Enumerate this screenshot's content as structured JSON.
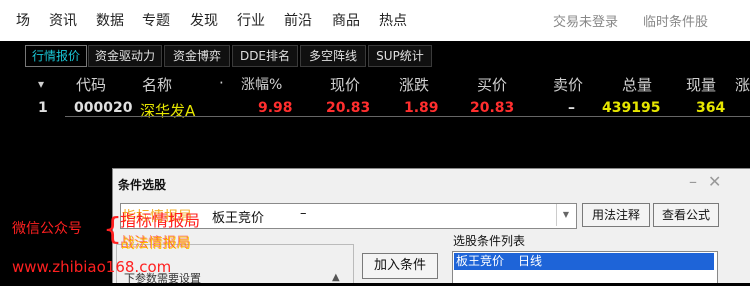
{
  "menu": {
    "items": [
      "场",
      "资讯",
      "数据",
      "专题",
      "发现",
      "行业",
      "前沿",
      "商品",
      "热点"
    ],
    "login_status": "交易未登录",
    "condition_stock": "临时条件股"
  },
  "tabs": [
    "行情报价",
    "资金驱动力",
    "资金博弈",
    "DDE排名",
    "多空阵线",
    "SUP统计"
  ],
  "table": {
    "sort_indicator": "▾",
    "dot": "·",
    "headers": [
      "代码",
      "名称",
      "涨幅%",
      "现价",
      "涨跌",
      "买价",
      "卖价",
      "总量",
      "现量",
      "涨"
    ],
    "rows": [
      {
        "index": "1",
        "code": "000020",
        "name": "深华发A",
        "change_pct": "9.98",
        "price": "20.83",
        "change": "1.89",
        "bid": "20.83",
        "ask": "–",
        "volume": "439195",
        "current_volume": "364"
      }
    ]
  },
  "dialog": {
    "title": "条件选股",
    "minimize": "–",
    "close": "✕",
    "formula_value": "板王竞价",
    "formula_dash": "–",
    "combo_arrow": "▼",
    "usage_button": "用法注释",
    "view_formula_button": "查看公式",
    "add_condition_button": "加入条件",
    "list_label": "选股条件列表",
    "list_items": [
      {
        "name": "板王竞价",
        "period": "日线"
      }
    ],
    "group_text": "下参数需要设置",
    "scroll_up": "▲"
  },
  "watermark": {
    "line1": "微信公众号",
    "brace": "{",
    "line2": "指标情报局",
    "line3": "战法情报局",
    "site": "www.zhibiao168.com",
    "ghost1": "指标情报局",
    "ghost2": "战法情报局"
  },
  "colors": {
    "tab_active": "#19c7d6",
    "up_red": "#ff2e2e",
    "yellow": "#e6e600",
    "selection_blue": "#1e64d8"
  }
}
